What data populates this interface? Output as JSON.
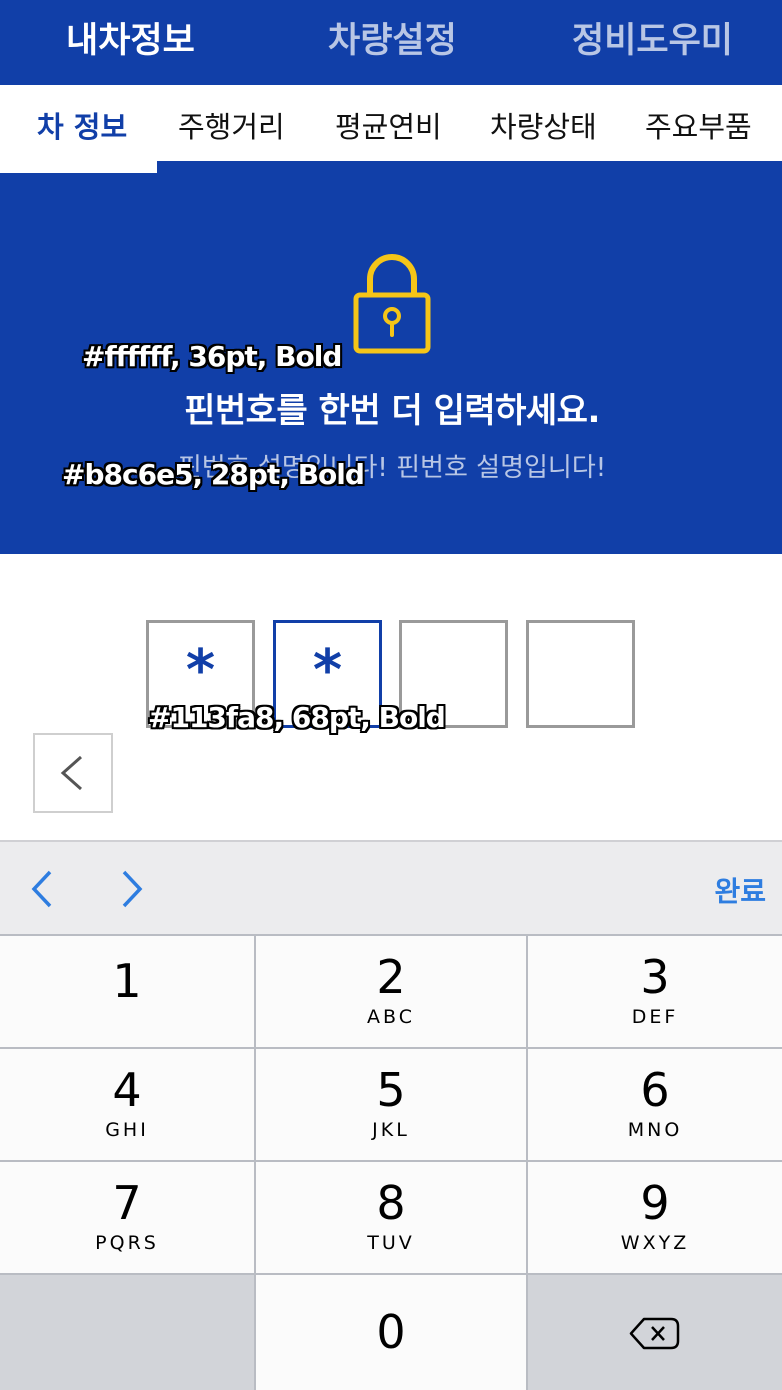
{
  "top_nav": {
    "tabs": [
      "내차정보",
      "차량설정",
      "정비도우미"
    ]
  },
  "sub_nav": {
    "tabs": [
      "차 정보",
      "주행거리",
      "평균연비",
      "차량상태",
      "주요부품"
    ]
  },
  "info": {
    "title": "핀번호를  한번 더 입력하세요.",
    "description": "핀번호 설명입니다! 핀번호 설명입니다!"
  },
  "annotations": [
    "#ffffff, 36pt, Bold",
    "#b8c6e5, 28pt, Bold",
    "#113fa8, 68pt, Bold"
  ],
  "pin": {
    "mask": "*",
    "filled": 2,
    "length": 4
  },
  "accessory": {
    "done_label": "완료"
  },
  "keypad": {
    "k1": {
      "num": "1",
      "letters": ""
    },
    "k2": {
      "num": "2",
      "letters": "ABC"
    },
    "k3": {
      "num": "3",
      "letters": "DEF"
    },
    "k4": {
      "num": "4",
      "letters": "GHI"
    },
    "k5": {
      "num": "5",
      "letters": "JKL"
    },
    "k6": {
      "num": "6",
      "letters": "MNO"
    },
    "k7": {
      "num": "7",
      "letters": "PQRS"
    },
    "k8": {
      "num": "8",
      "letters": "TUV"
    },
    "k9": {
      "num": "9",
      "letters": "WXYZ"
    },
    "k0": {
      "num": "0",
      "letters": ""
    }
  },
  "colors": {
    "brand_blue": "#113fa8",
    "muted_blue": "#b8c6e5",
    "lock_yellow": "#f5c518",
    "ios_blue": "#2e7de0"
  },
  "icons": [
    "lock-icon",
    "back-chevron-icon",
    "prev-field-icon",
    "next-field-icon",
    "delete-key-icon"
  ]
}
